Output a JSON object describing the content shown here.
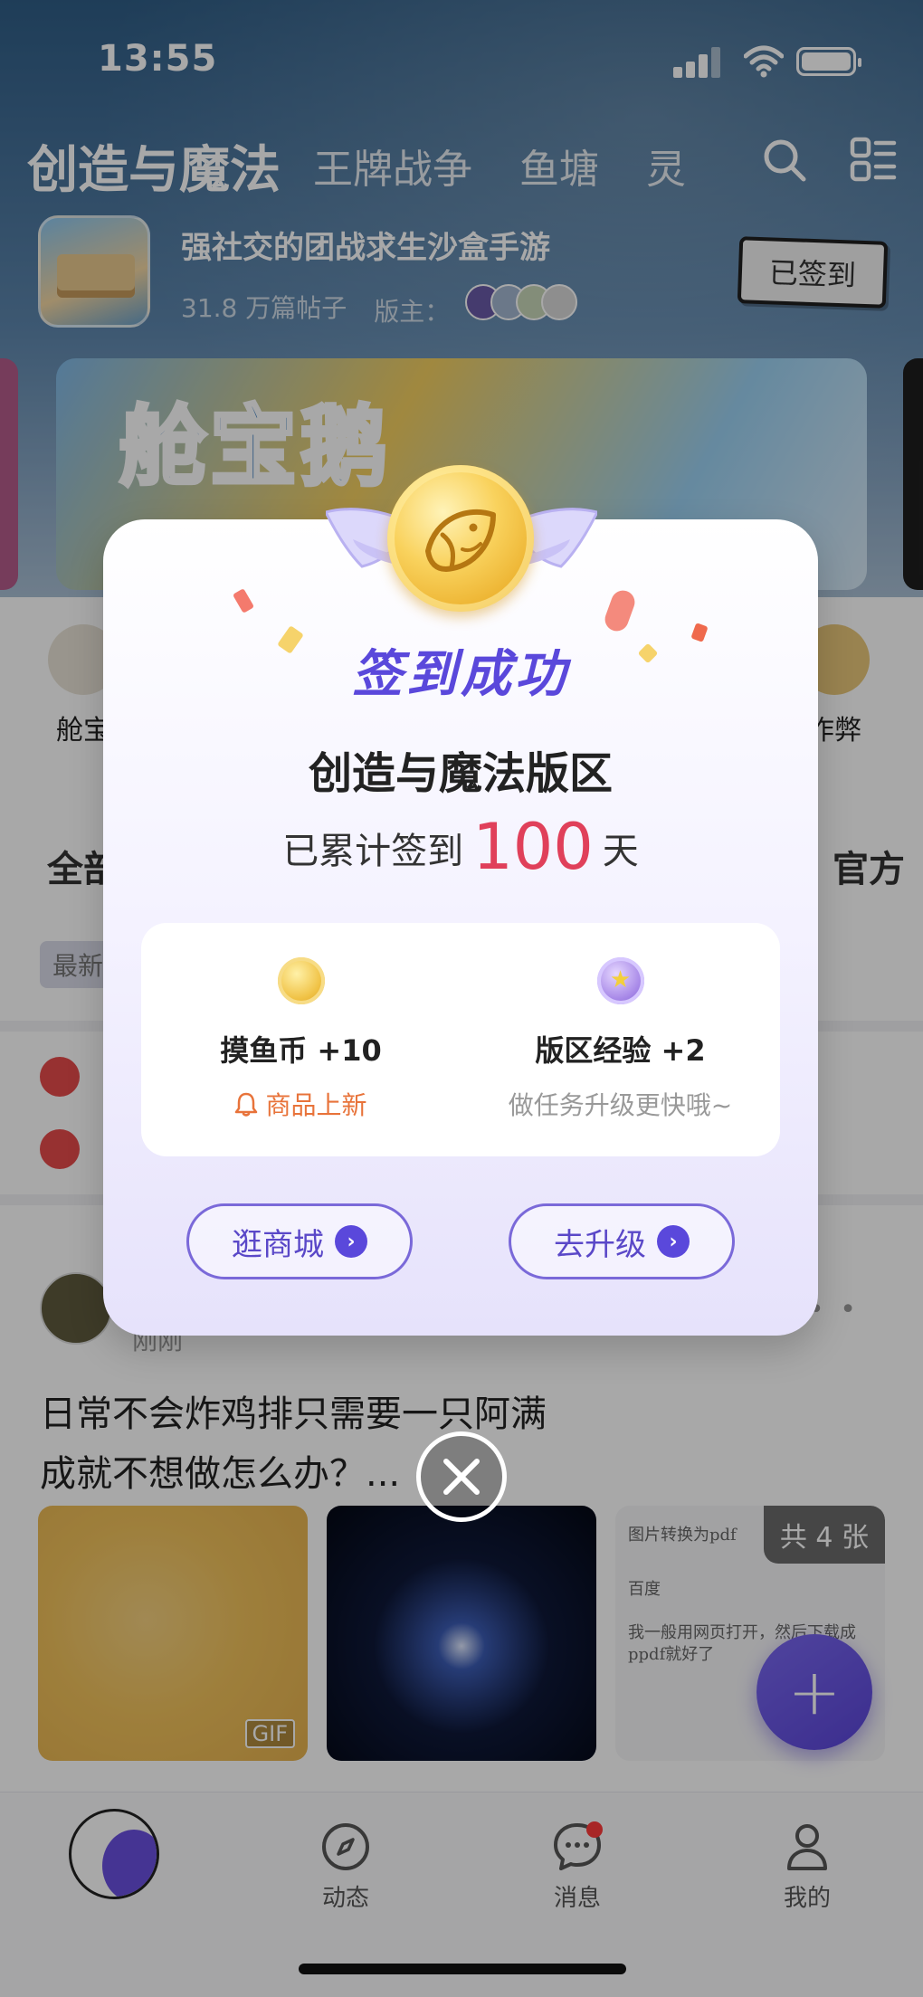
{
  "status_bar": {
    "time": "13:55"
  },
  "top_tabs": [
    "创造与魔法",
    "王牌战争",
    "鱼塘",
    "灵"
  ],
  "forum": {
    "title": "强社交的团战求生沙盒手游",
    "posts_count": "31.8 万篇帖子",
    "moderators_label": "版主：",
    "signed_label": "已签到"
  },
  "banner": {
    "title": "舱宝鹅"
  },
  "quick_entries": [
    "舱宝",
    "作弊"
  ],
  "filters": {
    "left": "全部",
    "right": "官方"
  },
  "sort_chip": "最新",
  "post": {
    "time": "刚刚",
    "text_line1": "日常不会炸鸡排只需要一只阿满",
    "text_line2": "成就不想做怎么办？...",
    "gif_tag": "GIF",
    "image_count": "共 4 张",
    "doc_lines": [
      "图片转换为pdf",
      "百度",
      "我一般用网页打开，然后下载成",
      "ppdf就好了"
    ]
  },
  "tabbar": {
    "items": [
      {
        "label": "动态",
        "icon": "compass-icon"
      },
      {
        "label": "消息",
        "icon": "chat-bubble-icon"
      },
      {
        "label": "我的",
        "icon": "person-icon"
      }
    ]
  },
  "modal": {
    "success_title": "签到成功",
    "forum_name": "创造与魔法版区",
    "days_prefix": "已累计签到",
    "days_count": "100",
    "days_suffix": "天",
    "rewards": [
      {
        "name": "摸鱼币 +10",
        "sub": "商品上新",
        "icon": "fish-coin-icon"
      },
      {
        "name": "版区经验 +2",
        "sub": "做任务升级更快哦~",
        "icon": "exp-star-icon"
      }
    ],
    "buttons": {
      "shop": "逛商城",
      "upgrade": "去升级"
    },
    "accent_color": "#5a48db",
    "highlight_color": "#e0405a"
  }
}
